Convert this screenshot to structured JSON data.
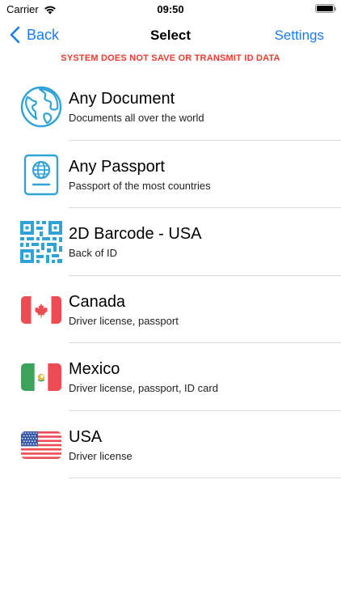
{
  "status_bar": {
    "carrier": "Carrier",
    "time": "09:50",
    "battery_level": 1.0
  },
  "nav": {
    "back_label": "Back",
    "title": "Select",
    "settings_label": "Settings"
  },
  "warning_text": "SYSTEM DOES NOT SAVE OR TRANSMIT ID DATA",
  "colors": {
    "accent": "#1a7cf5",
    "warning": "#ec3a2d",
    "icon_blue": "#2fa3d8"
  },
  "items": [
    {
      "title": "Any Document",
      "subtitle": "Documents all over the world",
      "icon": "globe-icon"
    },
    {
      "title": "Any Passport",
      "subtitle": "Passport of the most countries",
      "icon": "passport-icon"
    },
    {
      "title": "2D Barcode - USA",
      "subtitle": "Back of ID",
      "icon": "qr-code-icon"
    },
    {
      "title": "Canada",
      "subtitle": "Driver license, passport",
      "icon": "canada-flag-icon"
    },
    {
      "title": "Mexico",
      "subtitle": "Driver license, passport, ID card",
      "icon": "mexico-flag-icon"
    },
    {
      "title": "USA",
      "subtitle": "Driver license",
      "icon": "usa-flag-icon"
    }
  ]
}
